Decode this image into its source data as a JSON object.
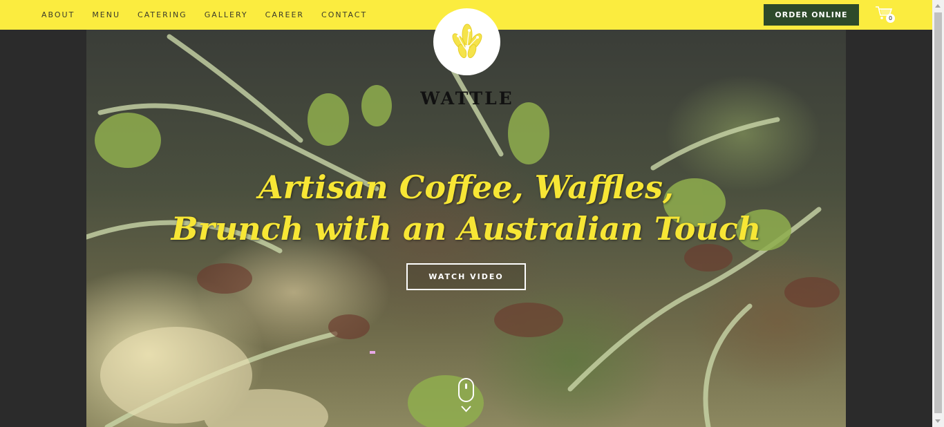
{
  "nav": {
    "items": [
      {
        "label": "ABOUT"
      },
      {
        "label": "MENU"
      },
      {
        "label": "CATERING"
      },
      {
        "label": "GALLERY"
      },
      {
        "label": "CAREER"
      },
      {
        "label": "CONTACT"
      }
    ]
  },
  "header": {
    "order_label": "ORDER ONLINE",
    "cart_count": "0",
    "cart_icon": "shopping-cart-icon"
  },
  "brand": {
    "name": "WATTLE",
    "logo_icon": "wattle-flower-icon"
  },
  "hero": {
    "headline_line1": "Artisan Coffee, Waffles,",
    "headline_line2": "Brunch with an Australian Touch",
    "watch_label": "WATCH VIDEO",
    "scroll_icon": "mouse-scroll-icon"
  },
  "colors": {
    "topbar": "#fbec3f",
    "accent_text": "#f7e635",
    "order_button": "#2d4a2a",
    "page_background": "#2b2b2b"
  }
}
